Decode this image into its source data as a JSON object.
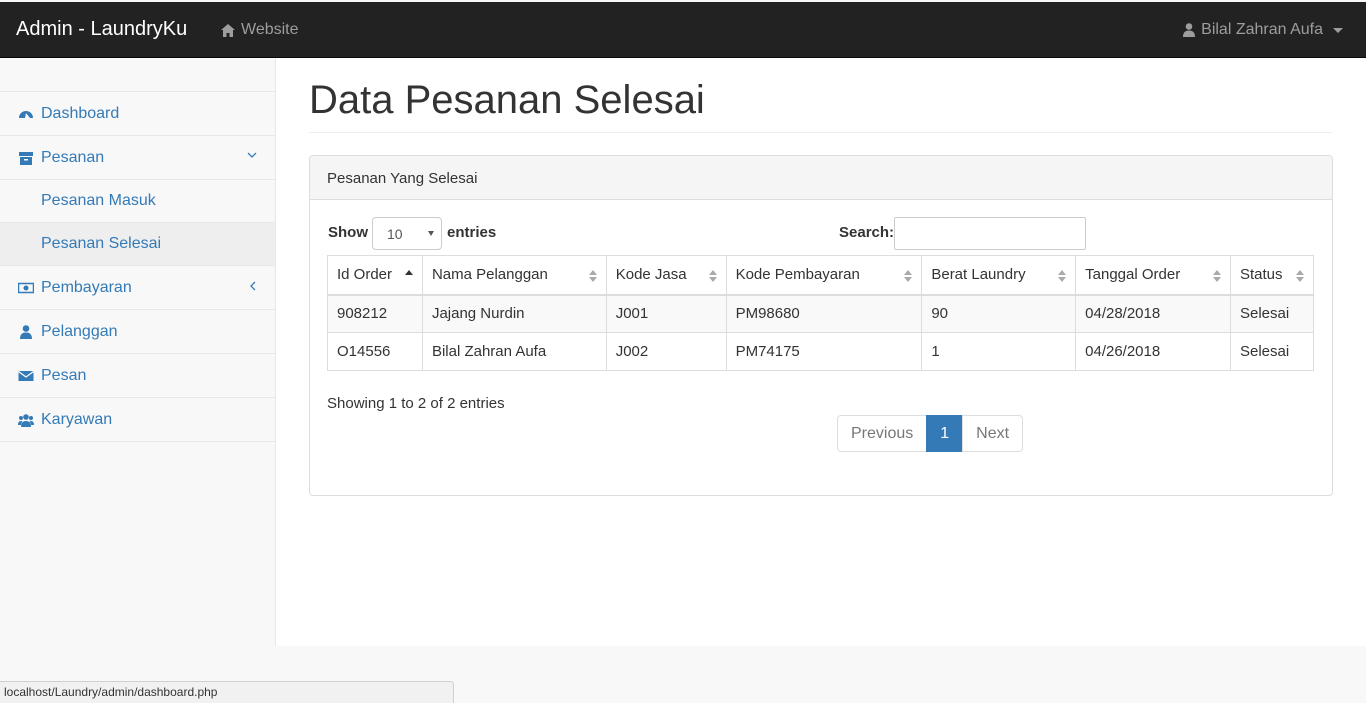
{
  "navbar": {
    "brand": "Admin - LaundryKu",
    "website_label": "Website",
    "user_name": "Bilal Zahran Aufa"
  },
  "sidebar": {
    "items": [
      {
        "label": "Dashboard",
        "icon": "dashboard-icon"
      },
      {
        "label": "Pesanan",
        "icon": "archive-icon",
        "expanded": true,
        "children": [
          {
            "label": "Pesanan Masuk",
            "active": false
          },
          {
            "label": "Pesanan Selesai",
            "active": true
          }
        ]
      },
      {
        "label": "Pembayaran",
        "icon": "money-icon"
      },
      {
        "label": "Pelanggan",
        "icon": "user-icon"
      },
      {
        "label": "Pesan",
        "icon": "envelope-icon"
      },
      {
        "label": "Karyawan",
        "icon": "users-icon"
      }
    ]
  },
  "page": {
    "title": "Data Pesanan Selesai"
  },
  "panel": {
    "heading": "Pesanan Yang Selesai",
    "show_label": "Show",
    "page_length": "10",
    "entries_label": "entries",
    "search_label": "Search:",
    "search_value": ""
  },
  "table": {
    "columns": [
      "Id Order",
      "Nama Pelanggan",
      "Kode Jasa",
      "Kode Pembayaran",
      "Berat Laundry",
      "Tanggal Order",
      "Status"
    ],
    "rows": [
      [
        "908212",
        "Jajang Nurdin",
        "J001",
        "PM98680",
        "90",
        "04/28/2018",
        "Selesai"
      ],
      [
        "O14556",
        "Bilal Zahran Aufa",
        "J002",
        "PM74175",
        "1",
        "04/26/2018",
        "Selesai"
      ]
    ]
  },
  "footer": {
    "info": "Showing 1 to 2 of 2 entries",
    "previous": "Previous",
    "current_page": "1",
    "next": "Next"
  },
  "statusbar": {
    "url": "localhost/Laundry/admin/dashboard.php"
  },
  "colors": {
    "navbar_bg": "#222222",
    "link": "#337ab7",
    "active_page": "#337ab7"
  }
}
